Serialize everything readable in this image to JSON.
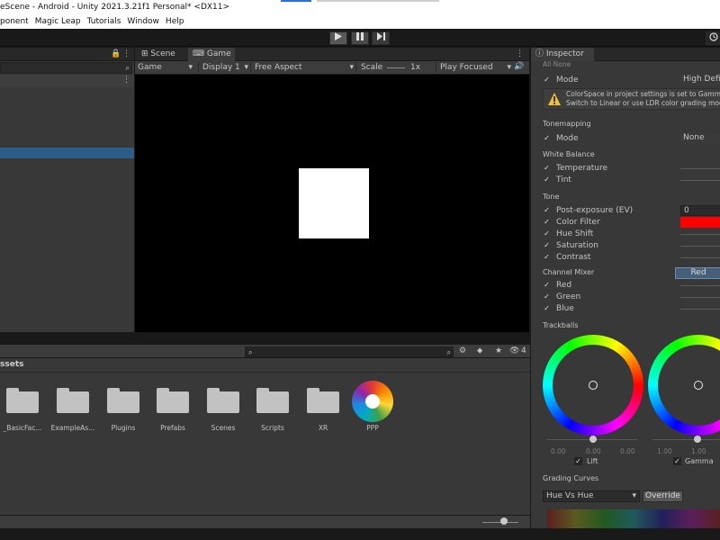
{
  "window": {
    "title": "eScene - Android - Unity 2021.3.21f1 Personal* <DX11>"
  },
  "menu": [
    "ponent",
    "Magic Leap",
    "Tutorials",
    "Window",
    "Help"
  ],
  "toolbar": {
    "play_icon": "play-icon",
    "pause_icon": "pause-icon",
    "step_icon": "step-icon",
    "history_icon": "history-icon"
  },
  "views": {
    "tabs": [
      {
        "label": "Scene",
        "icon": "grid-icon"
      },
      {
        "label": "Game",
        "icon": "gamepad-icon"
      }
    ],
    "game_dropdown": "Game",
    "display_dropdown": "Display 1",
    "aspect_dropdown": "Free Aspect",
    "scale_label": "Scale",
    "scale_value": "1x",
    "play_mode_dropdown": "Play Focused"
  },
  "project": {
    "header": "ssets",
    "search_placeholder": "",
    "hidden_count": "4",
    "folders": [
      "_BasicFac...",
      "ExampleAs...",
      "Plugins",
      "Prefabs",
      "Scenes",
      "Scripts",
      "XR"
    ],
    "asset": "PPP"
  },
  "inspector": {
    "tab_label": "Inspector",
    "all_none": "All None",
    "mode_label": "Mode",
    "mode_value": "High Defin",
    "warning_line1": "ColorSpace in project settings is set to Gamma",
    "warning_line2": "Switch to Linear or use LDR color grading mod",
    "tonemapping": {
      "title": "Tonemapping",
      "mode_label": "Mode",
      "mode_value": "None"
    },
    "white_balance": {
      "title": "White Balance",
      "temperature": "Temperature",
      "tint": "Tint"
    },
    "tone": {
      "title": "Tone",
      "post_exposure": "Post-exposure (EV)",
      "post_exposure_value": "0",
      "color_filter": "Color Filter",
      "color_filter_color": "#ff0000",
      "hue_shift": "Hue Shift",
      "saturation": "Saturation",
      "contrast": "Contrast"
    },
    "channel_mixer": {
      "title": "Channel Mixer",
      "selected": "Red",
      "red": "Red",
      "green": "Green",
      "blue": "Blue"
    },
    "trackballs": {
      "title": "Trackballs",
      "lift": {
        "label": "Lift",
        "values": [
          "0.00",
          "0.00",
          "0.00"
        ]
      },
      "gamma": {
        "label": "Gamma",
        "values": [
          "1.00",
          "1.00"
        ]
      }
    },
    "grading_curves": {
      "title": "Grading Curves",
      "dropdown": "Hue Vs Hue",
      "override": "Override"
    }
  },
  "colors": {
    "selection": "#2c5d87",
    "warning": "#f0c030"
  }
}
